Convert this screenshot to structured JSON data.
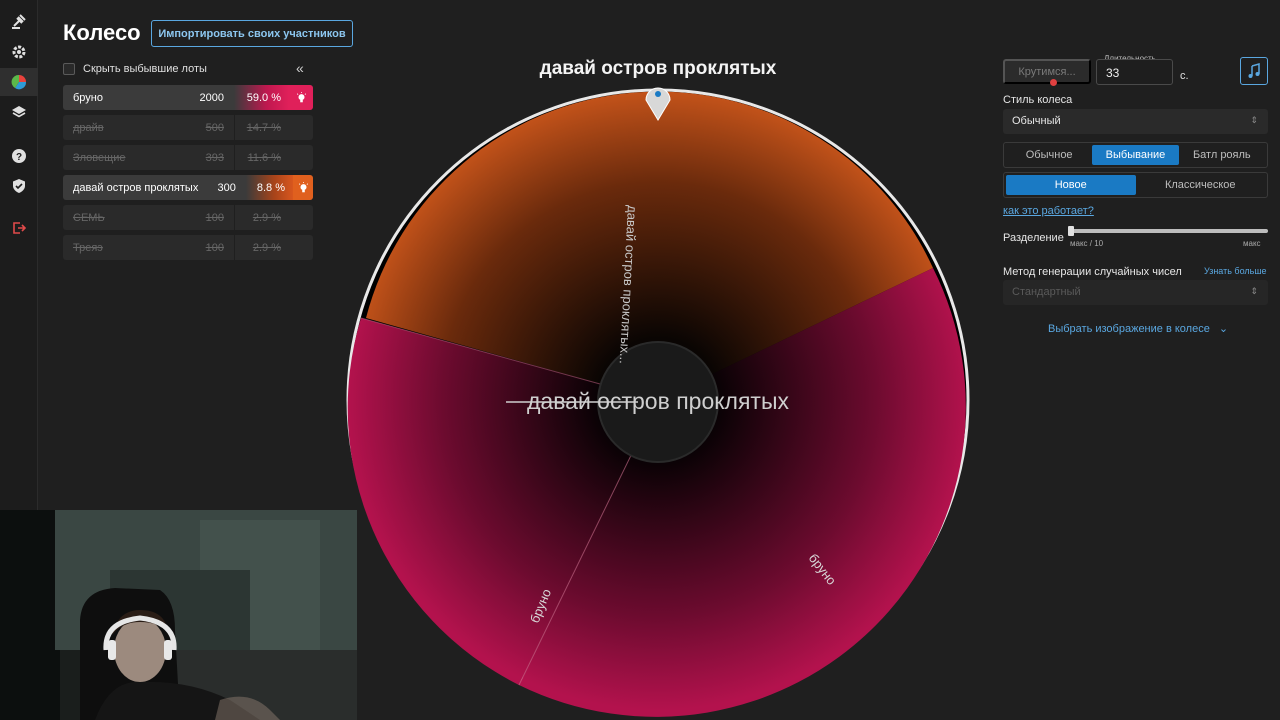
{
  "header": {
    "title": "Колесо",
    "import_button": "Импортировать своих участников"
  },
  "sidebar": {
    "icons": [
      "gavel-icon",
      "gear-icon",
      "pie-chart-icon",
      "layers-icon",
      "help-icon",
      "shield-icon",
      "logout-icon"
    ]
  },
  "lots_panel": {
    "hide_label": "Скрыть выбывшие лоты",
    "lots": [
      {
        "name": "бруно",
        "amount": "2000",
        "percent": "59.0 %",
        "state": "active"
      },
      {
        "name": "драйв",
        "amount": "500",
        "percent": "14.7 %",
        "state": "removed"
      },
      {
        "name": "Зловещие",
        "amount": "393",
        "percent": "11.6 %",
        "state": "removed"
      },
      {
        "name": "давай остров проклятых",
        "amount": "300",
        "percent": "8.8 %",
        "state": "active"
      },
      {
        "name": "СЕМЬ",
        "amount": "100",
        "percent": "2.9 %",
        "state": "removed"
      },
      {
        "name": "Треяэ",
        "amount": "100",
        "percent": "2.9 %",
        "state": "removed"
      }
    ]
  },
  "wheel": {
    "winner_title": "давай остров проклятых",
    "center_text": "давай остров проклятых",
    "segment_labels": {
      "top": "давай остров проклятых...",
      "right": "бруно",
      "left": "бруно"
    },
    "colors": {
      "orange": "#c4531a",
      "crimson": "#b3124d"
    }
  },
  "controls": {
    "spin_button": "Крутимся...",
    "duration_label": "Длительность",
    "duration_value": "33",
    "duration_unit": "с.",
    "wheel_style_label": "Стиль колеса",
    "wheel_style_value": "Обычный",
    "modes": [
      "Обычное",
      "Выбывание",
      "Батл рояль"
    ],
    "selected_mode": "Выбывание",
    "variants": [
      "Новое",
      "Классическое"
    ],
    "selected_variant": "Новое",
    "how_link": "как это работает?",
    "split_label": "Разделение",
    "split_min": "макс / 10",
    "split_max": "макс",
    "rng_label": "Метод генерации случайных чисел",
    "rng_link": "Узнать больше",
    "rng_value": "Стандартный",
    "image_link": "Выбрать изображение в колесе"
  }
}
